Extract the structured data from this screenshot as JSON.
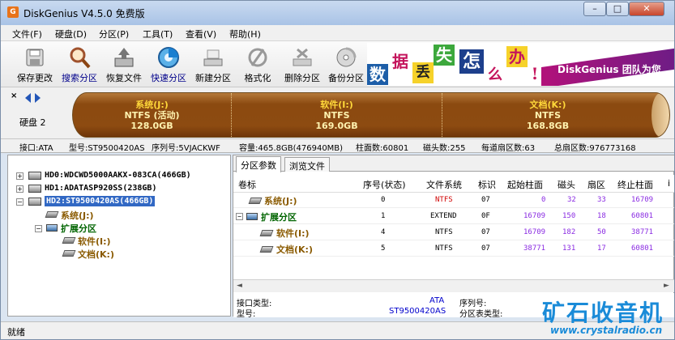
{
  "window": {
    "title": "DiskGenius V4.5.0 免费版",
    "icon_label": "G",
    "controls": {
      "minimize": "–",
      "maximize": "□",
      "close": "✕"
    }
  },
  "menu": [
    "文件(F)",
    "硬盘(D)",
    "分区(P)",
    "工具(T)",
    "查看(V)",
    "帮助(H)"
  ],
  "toolbar": [
    {
      "label": "保存更改",
      "icon": "save-icon"
    },
    {
      "label": "搜索分区",
      "icon": "search-icon"
    },
    {
      "label": "恢复文件",
      "icon": "recover-icon"
    },
    {
      "label": "快速分区",
      "icon": "quick-partition-icon"
    },
    {
      "label": "新建分区",
      "icon": "new-partition-icon"
    },
    {
      "label": "格式化",
      "icon": "format-icon"
    },
    {
      "label": "删除分区",
      "icon": "delete-icon"
    },
    {
      "label": "备份分区",
      "icon": "backup-icon"
    }
  ],
  "banner": {
    "chars": [
      "数",
      "据",
      "丢",
      "失",
      "怎",
      "么",
      "办",
      "!"
    ],
    "text": "DiskGenius 团队为您"
  },
  "diskbar": {
    "label": "硬盘 2",
    "partitions": [
      {
        "name": "系统(J:)",
        "fs": "NTFS (活动)",
        "size": "128.0GB"
      },
      {
        "name": "软件(I:)",
        "fs": "NTFS",
        "size": "169.0GB"
      },
      {
        "name": "文档(K:)",
        "fs": "NTFS",
        "size": "168.8GB"
      }
    ]
  },
  "infobar": {
    "interface": "接口:ATA",
    "model": "型号:ST9500420AS",
    "serial": "序列号:5VJACKWF",
    "capacity": "容量:465.8GB(476940MB)",
    "cylinders": "柱面数:60801",
    "heads": "磁头数:255",
    "sectors_per_track": "每道扇区数:63",
    "total_sectors": "总扇区数:976773168"
  },
  "tree": {
    "disks": [
      {
        "label": "HD0:WDCWD5000AAKX-083CA(466GB)"
      },
      {
        "label": "HD1:ADATASP920SS(238GB)"
      },
      {
        "label": "HD2:ST9500420AS(466GB)"
      }
    ],
    "hd2_children": {
      "system": "系统(J:)",
      "extended": "扩展分区",
      "software": "软件(I:)",
      "docs": "文档(K:)"
    }
  },
  "tabs": [
    "分区参数",
    "浏览文件"
  ],
  "table": {
    "headers": [
      "卷标",
      "序号(状态)",
      "文件系统",
      "标识",
      "起始柱面",
      "磁头",
      "扇区",
      "终止柱面",
      "i"
    ],
    "rows": [
      {
        "name": "系统(J:)",
        "index": "0",
        "fs": "NTFS",
        "id": "07",
        "start_cyl": "0",
        "head": "32",
        "sector": "33",
        "end_cyl": "16709"
      },
      {
        "name": "扩展分区",
        "index": "1",
        "fs": "EXTEND",
        "id": "0F",
        "start_cyl": "16709",
        "head": "150",
        "sector": "18",
        "end_cyl": "60801"
      },
      {
        "name": "软件(I:)",
        "index": "4",
        "fs": "NTFS",
        "id": "07",
        "start_cyl": "16709",
        "head": "182",
        "sector": "50",
        "end_cyl": "38771"
      },
      {
        "name": "文档(K:)",
        "index": "5",
        "fs": "NTFS",
        "id": "07",
        "start_cyl": "38771",
        "head": "131",
        "sector": "17",
        "end_cyl": "60801"
      }
    ]
  },
  "bottom_info": {
    "interface_type_label": "接口类型:",
    "interface_type_value": "ATA",
    "model_label": "型号:",
    "model_value": "ST9500420AS",
    "serial_label": "序列号:",
    "ptable_label": "分区表类型:"
  },
  "status": "就绪",
  "watermark": {
    "big": "矿石收音机",
    "url": "www.crystalradio.cn"
  },
  "colors": {
    "partition_text": "#ffd83a",
    "partition_bar": "#8b4a10",
    "selection": "#3168c4"
  }
}
